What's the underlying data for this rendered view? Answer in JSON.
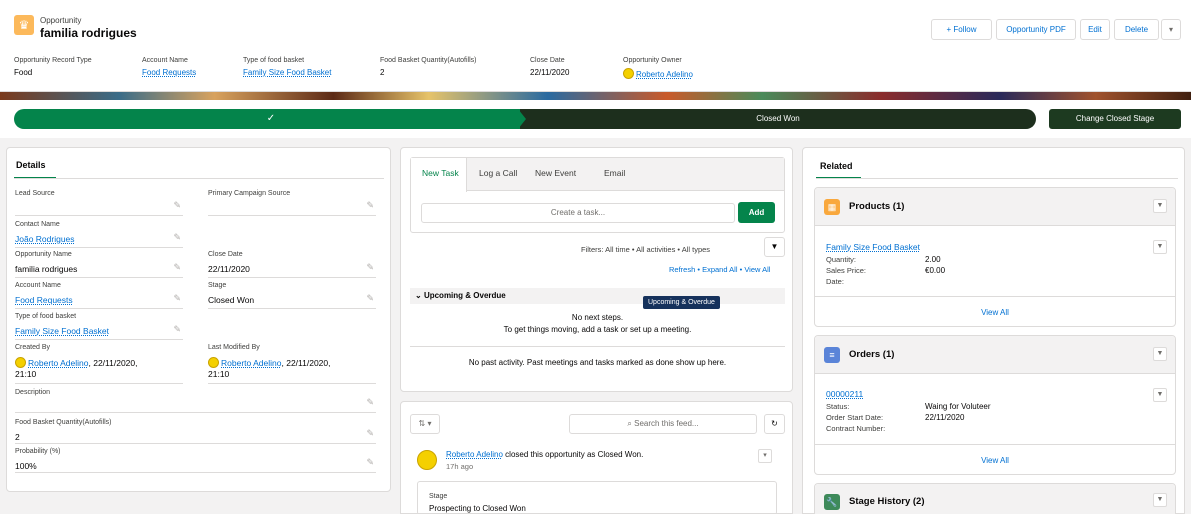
{
  "header": {
    "object_type": "Opportunity",
    "record_title": "familia rodrigues",
    "follow_label": "+ Follow",
    "pdf_label": "Opportunity PDF",
    "edit_label": "Edit",
    "delete_label": "Delete",
    "fields": [
      {
        "label": "Opportunity Record Type",
        "value": "Food"
      },
      {
        "label": "Account Name",
        "value": "Food Requests"
      },
      {
        "label": "Type of food basket",
        "value": "Family Size Food Basket"
      },
      {
        "label": "Food Basket Quantity(Autofills)",
        "value": "2"
      },
      {
        "label": "Close Date",
        "value": "22/11/2020"
      },
      {
        "label": "Opportunity Owner",
        "value": "Roberto Adelino"
      }
    ]
  },
  "path": {
    "completed_check": "✓",
    "current_stage": "Closed Won",
    "change_button": "Change Closed Stage"
  },
  "details": {
    "tab_label": "Details",
    "fields": [
      {
        "label": "Lead Source",
        "value": ""
      },
      {
        "label": "Primary Campaign Source",
        "value": ""
      },
      {
        "label": "Contact Name",
        "value": "João Rodrigues"
      },
      {
        "label": "Opportunity Name",
        "value": "familia rodrigues"
      },
      {
        "label": "Close Date",
        "value": "22/11/2020"
      },
      {
        "label": "Account Name",
        "value": "Food Requests"
      },
      {
        "label": "Stage",
        "value": "Closed Won"
      },
      {
        "label": "Type of food basket",
        "value": "Family Size Food Basket"
      },
      {
        "label": "Created By",
        "value": "Roberto Adelino",
        "extra": ", 22/11/2020,",
        "extra2": "21:10"
      },
      {
        "label": "Last Modified By",
        "value": "Roberto Adelino",
        "extra": ", 22/11/2020,",
        "extra2": "21:10"
      },
      {
        "label": "Description",
        "value": ""
      },
      {
        "label": "Food Basket Quantity(Autofills)",
        "value": "2"
      },
      {
        "label": "Probability (%)",
        "value": "100%"
      }
    ]
  },
  "activity": {
    "tabs": [
      "New Task",
      "Log a Call",
      "New Event",
      "Email"
    ],
    "task_placeholder": "Create a task...",
    "add_label": "Add",
    "filters_text": "Filters: All time • All activities • All types",
    "refresh": "Refresh",
    "expand_all": "Expand All",
    "view_all": "View All",
    "upcoming_header": "Upcoming & Overdue",
    "tooltip": "Upcoming & Overdue",
    "no_steps": "No next steps.",
    "no_steps_hint": "To get things moving, add a task or set up a meeting.",
    "no_past": "No past activity. Past meetings and tasks marked as done show up here."
  },
  "feed": {
    "search_placeholder": "Search this feed...",
    "author": "Roberto Adelino",
    "action": " closed this opportunity as Closed Won.",
    "time": "17h ago",
    "stage_label": "Stage",
    "stage_change": "Prospecting to Closed Won"
  },
  "related": {
    "tab_label": "Related",
    "products": {
      "title": "Products (1)",
      "item_name": "Family Size Food Basket",
      "rows": [
        {
          "label": "Quantity:",
          "value": "2.00"
        },
        {
          "label": "Sales Price:",
          "value": "€0.00"
        },
        {
          "label": "Date:",
          "value": ""
        }
      ],
      "view_all": "View All"
    },
    "orders": {
      "title": "Orders (1)",
      "item_name": "00000211",
      "rows": [
        {
          "label": "Status:",
          "value": "Waing for Voluteer"
        },
        {
          "label": "Order Start Date:",
          "value": "22/11/2020"
        },
        {
          "label": "Contract Number:",
          "value": ""
        }
      ],
      "view_all": "View All"
    },
    "stage_history": {
      "title": "Stage History (2)"
    }
  },
  "colors": {
    "brand_green": "#04844b",
    "dark_green": "#1d3a20",
    "link_blue": "#0070d2",
    "opportunity_icon": "#fcb95b"
  }
}
